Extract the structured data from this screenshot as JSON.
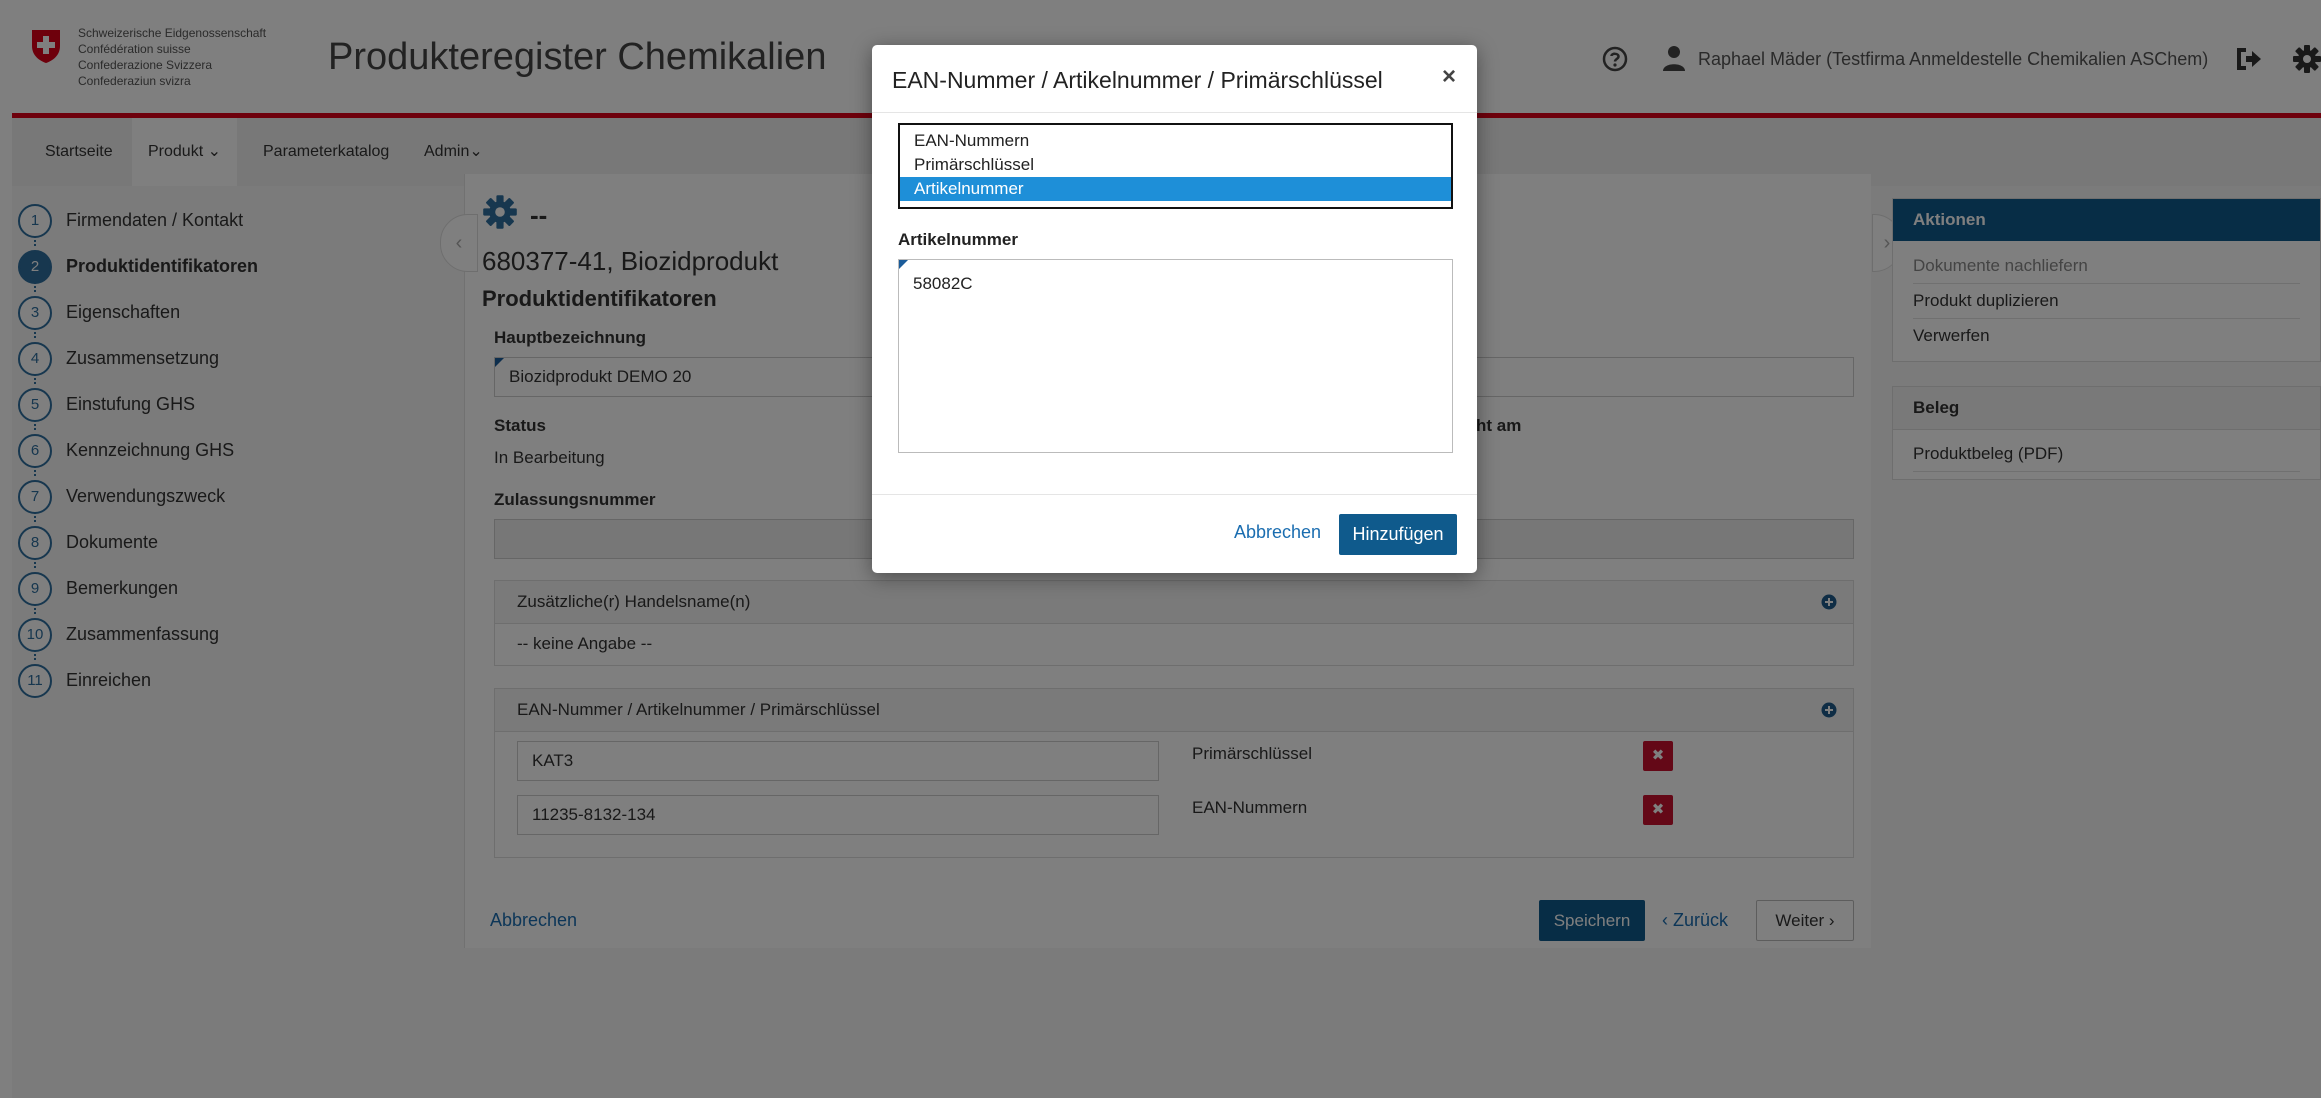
{
  "header": {
    "confed_names": [
      "Schweizerische Eidgenossenschaft",
      "Confédération suisse",
      "Confederazione Svizzera",
      "Confederaziun svizra"
    ],
    "app_title": "Produkteregister Chemikalien",
    "user_name": "Raphael Mäder (Testfirma Anmeldestelle Chemikalien ASChem)"
  },
  "nav": {
    "items": [
      {
        "label": "Startseite"
      },
      {
        "label": "Produkt ⌄"
      },
      {
        "label": "Parameterkatalog"
      },
      {
        "label": "Admin⌄"
      }
    ]
  },
  "steps": [
    {
      "num": "1",
      "label": "Firmendaten / Kontakt"
    },
    {
      "num": "2",
      "label": "Produktidentifikatoren"
    },
    {
      "num": "3",
      "label": "Eigenschaften"
    },
    {
      "num": "4",
      "label": "Zusammensetzung"
    },
    {
      "num": "5",
      "label": "Einstufung GHS"
    },
    {
      "num": "6",
      "label": "Kennzeichnung GHS"
    },
    {
      "num": "7",
      "label": "Verwendungszweck"
    },
    {
      "num": "8",
      "label": "Dokumente"
    },
    {
      "num": "9",
      "label": "Bemerkungen"
    },
    {
      "num": "10",
      "label": "Zusammenfassung"
    },
    {
      "num": "11",
      "label": "Einreichen"
    }
  ],
  "product": {
    "dash": "--",
    "number_type": "680377-41, Biozidprodukt",
    "section_title": "Produktidentifikatoren",
    "hauptbezeichnung_label": "Hauptbezeichnung",
    "hauptbezeichnung_value": "Biozidprodukt DEMO 20",
    "status_label": "Status",
    "status_value": "In Bearbeitung",
    "partial_label": "ht am",
    "zulassungsnummer_label": "Zulassungsnummer",
    "zulassungsnummer_value": ""
  },
  "handelsname_panel": {
    "title": "Zusätzliche(r) Handelsname(n)",
    "empty_text": "-- keine Angabe --"
  },
  "ean_panel": {
    "title": "EAN-Nummer / Artikelnummer / Primärschlüssel",
    "rows": [
      {
        "value": "KAT3",
        "type": "Primärschlüssel"
      },
      {
        "value": "11235-8132-134",
        "type": "EAN-Nummern"
      }
    ]
  },
  "footer": {
    "cancel": "Abbrechen",
    "save": "Speichern",
    "back": "‹  Zurück",
    "next": "Weiter ›"
  },
  "actions": {
    "title": "Aktionen",
    "items": [
      "Dokumente nachliefern",
      "Produkt duplizieren",
      "Verwerfen"
    ]
  },
  "beleg": {
    "title": "Beleg",
    "items": [
      "Produktbeleg (PDF)"
    ]
  },
  "modal": {
    "title": "EAN-Nummer / Artikelnummer / Primärschlüssel",
    "close": "×",
    "options": [
      "EAN-Nummern",
      "Primärschlüssel",
      "Artikelnummer"
    ],
    "selected_option": "Artikelnummer",
    "field_label": "Artikelnummer",
    "field_value": "58082C",
    "cancel": "Abbrechen",
    "add": "Hinzufügen"
  },
  "colors": {
    "brand_red": "#dc0018",
    "primary_blue": "#0f5a8c",
    "step_blue": "#2e6e9e",
    "delete_red": "#c8102e",
    "selection_blue": "#1e8fd8"
  },
  "icons": [
    "swiss-crest-icon",
    "help-icon",
    "user-icon",
    "logout-icon",
    "gear-icon",
    "plus-circle-icon",
    "delete-icon",
    "chevron-left-icon",
    "chevron-right-icon",
    "close-icon"
  ]
}
